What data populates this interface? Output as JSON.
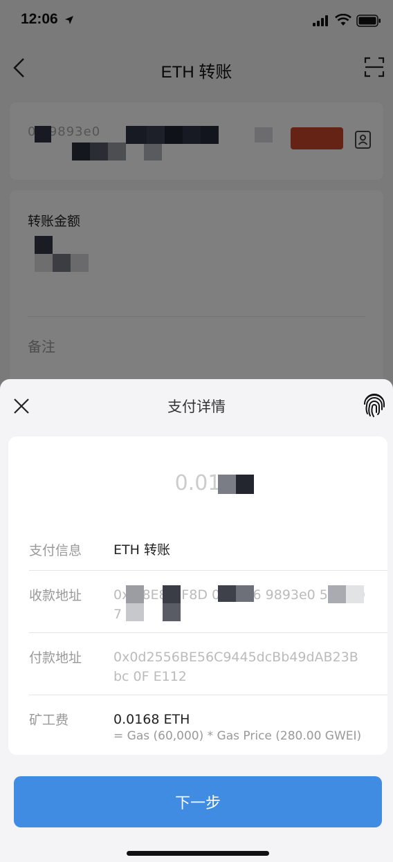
{
  "status_bar": {
    "time": "12:06"
  },
  "nav": {
    "title": "ETH 转账"
  },
  "address_card": {
    "address_text": "0x                    9893e0"
  },
  "amount_card": {
    "amount_label": "转账金额",
    "memo_placeholder": "备注"
  },
  "sheet": {
    "title": "支付详情",
    "amount": "0.01",
    "rows": [
      {
        "label": "支付信息",
        "value": "ETH 转账"
      },
      {
        "label": "收款地址",
        "value": "0x   98E8D   F8D   0x3E86   9893e0   5       c1C07"
      },
      {
        "label": "付款地址",
        "value": "0x0d2556BE56C9445dcBb49dAB23B bc    0F    E112"
      },
      {
        "label": "矿工费",
        "value": "0.0168 ETH",
        "sub": "= Gas (60,000) * Gas Price (280.00 GWEI)"
      }
    ],
    "next_button": "下一步"
  },
  "colors": {
    "accent": "#3f8ce2",
    "tag": "#c9472a",
    "sheet_bg": "#f4f4f6"
  }
}
